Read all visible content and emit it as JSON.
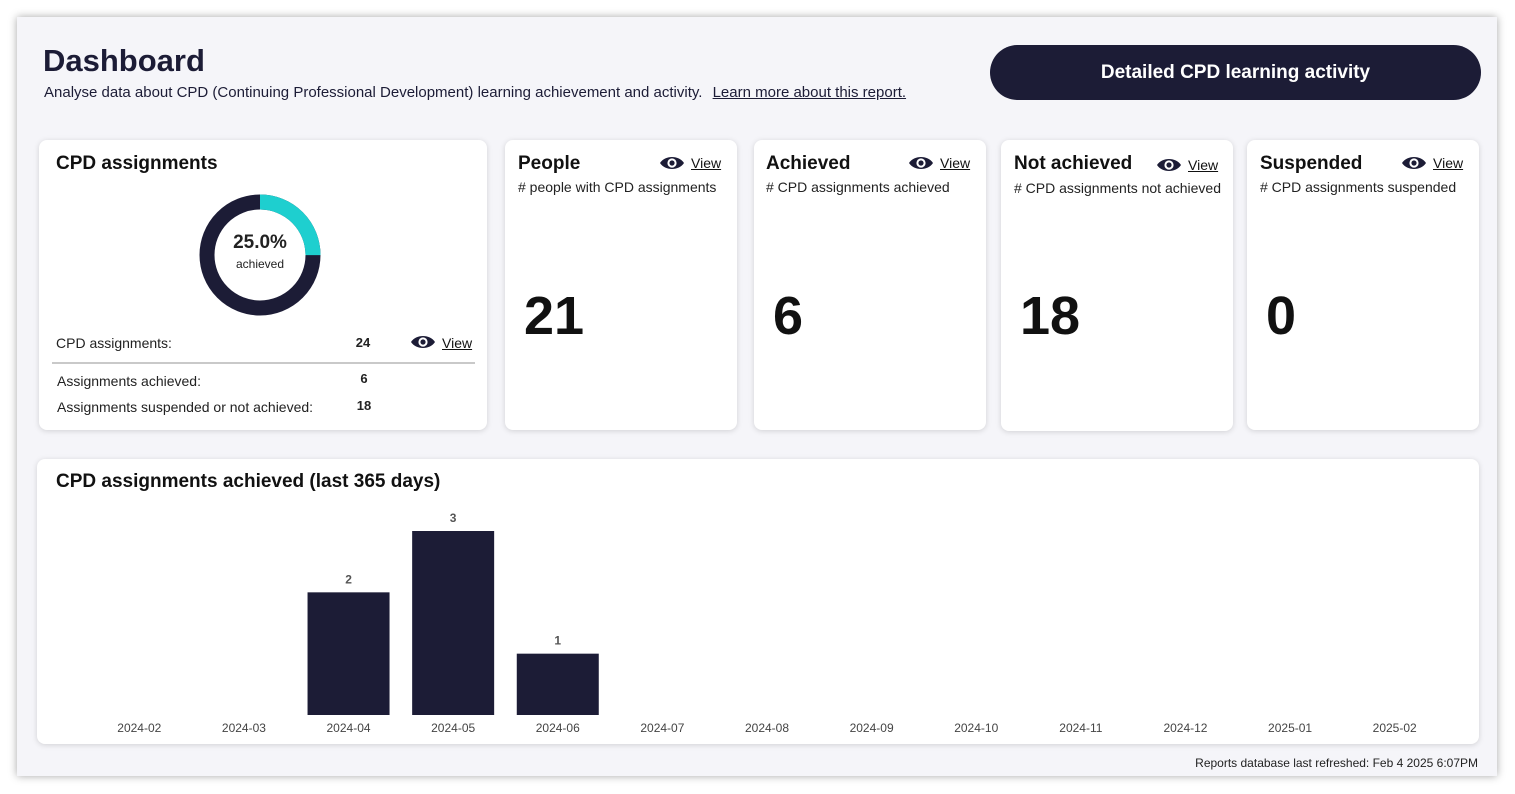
{
  "header": {
    "title": "Dashboard",
    "subtitle": "Analyse data about CPD (Continuing Professional Development) learning achievement and activity.",
    "learn_more": "Learn more about this report.",
    "button_label": "Detailed CPD learning activity"
  },
  "cpd_card": {
    "title": "CPD assignments",
    "percent": "25.0%",
    "percent_label": "achieved",
    "achieved_fraction": 0.25,
    "rows": [
      {
        "label": "CPD assignments:",
        "value": "24",
        "view": "View"
      },
      {
        "label": "Assignments achieved:",
        "value": "6"
      },
      {
        "label": "Assignments suspended or not achieved:",
        "value": "18"
      }
    ]
  },
  "stat_cards": [
    {
      "title": "People",
      "subtitle": "# people with CPD assignments",
      "value": "21",
      "view": "View"
    },
    {
      "title": "Achieved",
      "subtitle": "# CPD assignments achieved",
      "value": "6",
      "view": "View"
    },
    {
      "title": "Not achieved",
      "subtitle": "# CPD assignments not achieved",
      "value": "18",
      "view": "View"
    },
    {
      "title": "Suspended",
      "subtitle": "# CPD assignments suspended",
      "value": "0",
      "view": "View"
    }
  ],
  "colors": {
    "accent": "#1ecfcf",
    "navy": "#1c1c36"
  },
  "chart_data": {
    "type": "bar",
    "title": "CPD assignments achieved (last 365 days)",
    "categories": [
      "2024-02",
      "2024-03",
      "2024-04",
      "2024-05",
      "2024-06",
      "2024-07",
      "2024-08",
      "2024-09",
      "2024-10",
      "2024-11",
      "2024-12",
      "2025-01",
      "2025-02"
    ],
    "values": [
      0,
      0,
      2,
      3,
      1,
      0,
      0,
      0,
      0,
      0,
      0,
      0,
      0
    ],
    "ylim": [
      0,
      3
    ],
    "grid": false,
    "color": "#1c1c36"
  },
  "footer": {
    "refreshed": "Reports database last refreshed: Feb  4 2025  6:07PM"
  }
}
